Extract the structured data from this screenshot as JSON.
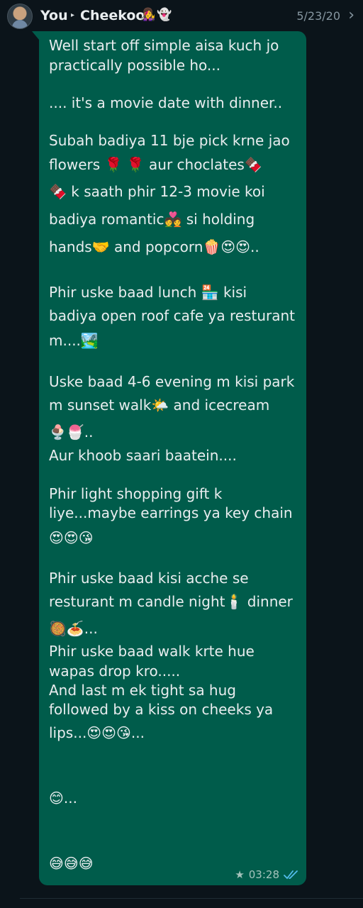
{
  "header": {
    "from": "You",
    "arrow": "▸",
    "to": "Cheekoo",
    "to_emojis": [
      "👩‍🎤",
      "👻"
    ],
    "date": "5/23/20",
    "chevron": "›"
  },
  "message": {
    "lines": [
      "Well start off simple aisa kuch jo",
      "practically possible ho...",
      ".... it's a movie date with dinner..",
      "Subah badiya 11 bje pick krne jao",
      "flowers 🌹 🌹 aur choclates🍫",
      "🍫 k saath phir 12-3 movie koi",
      "badiya romantic💑 si holding",
      "hands🤝 and popcorn🍿😍😍..",
      "Phir uske baad lunch 🏪 kisi",
      "badiya open roof cafe ya resturant",
      "m....🏞️",
      "Uske baad 4-6 evening m kisi park",
      "m sunset walk🌤️ and icecream",
      "🍨🍧..",
      "Aur khoob saari baatein....",
      "Phir light shopping gift k",
      "liye...maybe earrings ya key chain",
      "😍😍😘",
      "Phir uske baad kisi acche se",
      "resturant m candle night🕯️ dinner",
      "🥘🍝...",
      "Phir uske baad walk krte hue",
      "wapas drop kro.....",
      "And last m ek tight sa hug",
      "followed by a kiss on cheeks ya",
      "lips...😍😍😘...",
      "😊...",
      "😅😅😅"
    ],
    "starred": "★",
    "time": "03:28",
    "read_status": "read"
  }
}
